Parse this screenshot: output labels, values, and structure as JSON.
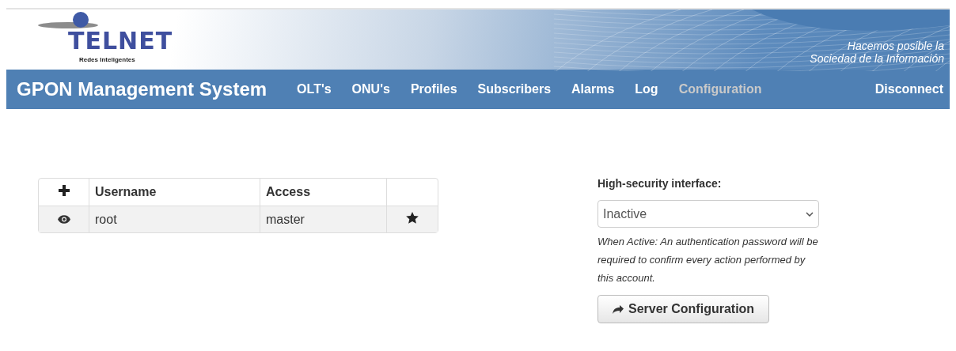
{
  "header": {
    "logo_text": "TELNET",
    "logo_subtitle": "Redes Inteligentes",
    "slogan_line_1": "Hacemos posible la",
    "slogan_line_2": "Sociedad de la Información"
  },
  "nav": {
    "title": "GPON Management System",
    "items": [
      {
        "label": "OLT's",
        "selected": false
      },
      {
        "label": "ONU's",
        "selected": false
      },
      {
        "label": "Profiles",
        "selected": false
      },
      {
        "label": "Subscribers",
        "selected": false
      },
      {
        "label": "Alarms",
        "selected": false
      },
      {
        "label": "Log",
        "selected": false
      },
      {
        "label": "Configuration",
        "selected": true
      }
    ],
    "disconnect": "Disconnect"
  },
  "users_table": {
    "columns": [
      "Username",
      "Access"
    ],
    "rows": [
      {
        "username": "root",
        "access": "master",
        "master": true
      }
    ]
  },
  "security": {
    "label": "High-security interface:",
    "value": "Inactive",
    "note": "When Active: An authentication password will be required to confirm every action performed by this account.",
    "button": "Server Configuration"
  }
}
